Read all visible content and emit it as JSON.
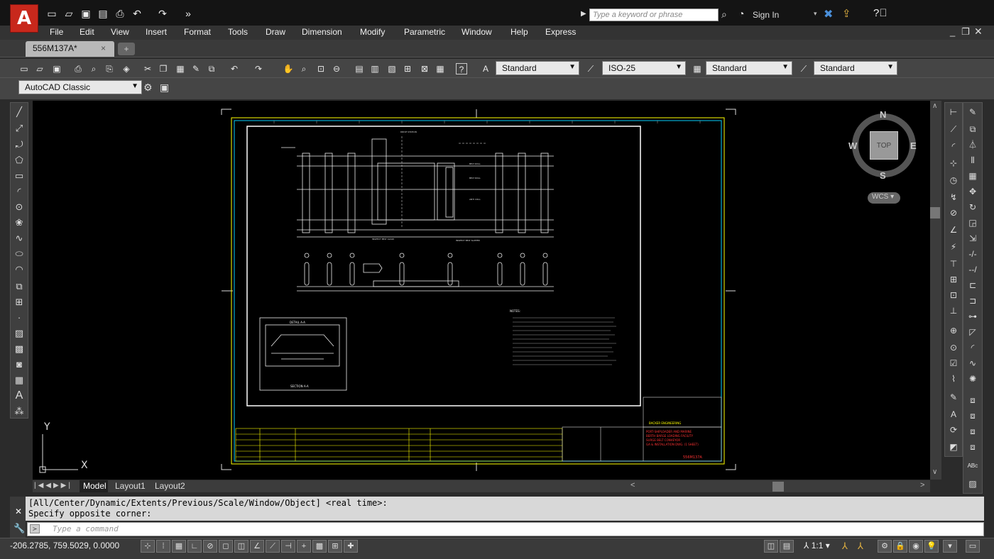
{
  "app": {
    "logo_letter": "A"
  },
  "quick_access": {
    "icons": [
      "new-icon",
      "open-icon",
      "save-icon",
      "saveas-icon",
      "plot-icon",
      "undo-icon",
      "redo-icon",
      "more-icon"
    ]
  },
  "titlebar": {
    "search_placeholder": "Type a keyword or phrase",
    "sign_in": "Sign In"
  },
  "menu": {
    "items": [
      "File",
      "Edit",
      "View",
      "Insert",
      "Format",
      "Tools",
      "Draw",
      "Dimension",
      "Modify",
      "Parametric",
      "Window",
      "Help",
      "Express"
    ]
  },
  "tabs": {
    "active": "556M137A*",
    "close": "×"
  },
  "styles": {
    "text_style": "Standard",
    "dim_style": "ISO-25",
    "table_style": "Standard",
    "mleader_style": "Standard"
  },
  "workspace": {
    "name": "AutoCAD Classic"
  },
  "viewcube": {
    "n": "N",
    "s": "S",
    "e": "E",
    "w": "W",
    "face": "TOP",
    "ucs": "WCS"
  },
  "ucs_icon": {
    "x": "X",
    "y": "Y"
  },
  "layouts": {
    "items": [
      "Model",
      "Layout1",
      "Layout2"
    ]
  },
  "command": {
    "history": [
      "[All/Center/Dynamic/Extents/Previous/Scale/Window/Object] <real time>:",
      "Specify opposite corner:"
    ],
    "placeholder": "Type a command"
  },
  "status": {
    "coords": "-206.2785, 759.5029, 0.0000",
    "scale": "1:1"
  },
  "drawing": {
    "title_block_text": [
      "PORT-SHIPLOADER AND MARINE",
      "BERTH BARGE LOADING FACILITY",
      "SURGE BELT CONVEYOR",
      "GA & INSTALLATION DWG. (1 SHEET)"
    ],
    "drawing_no": "556M137A",
    "section_label": "SECTION A-A",
    "notes_label": "NOTES:",
    "company": "BACKER ENGINEERING"
  }
}
